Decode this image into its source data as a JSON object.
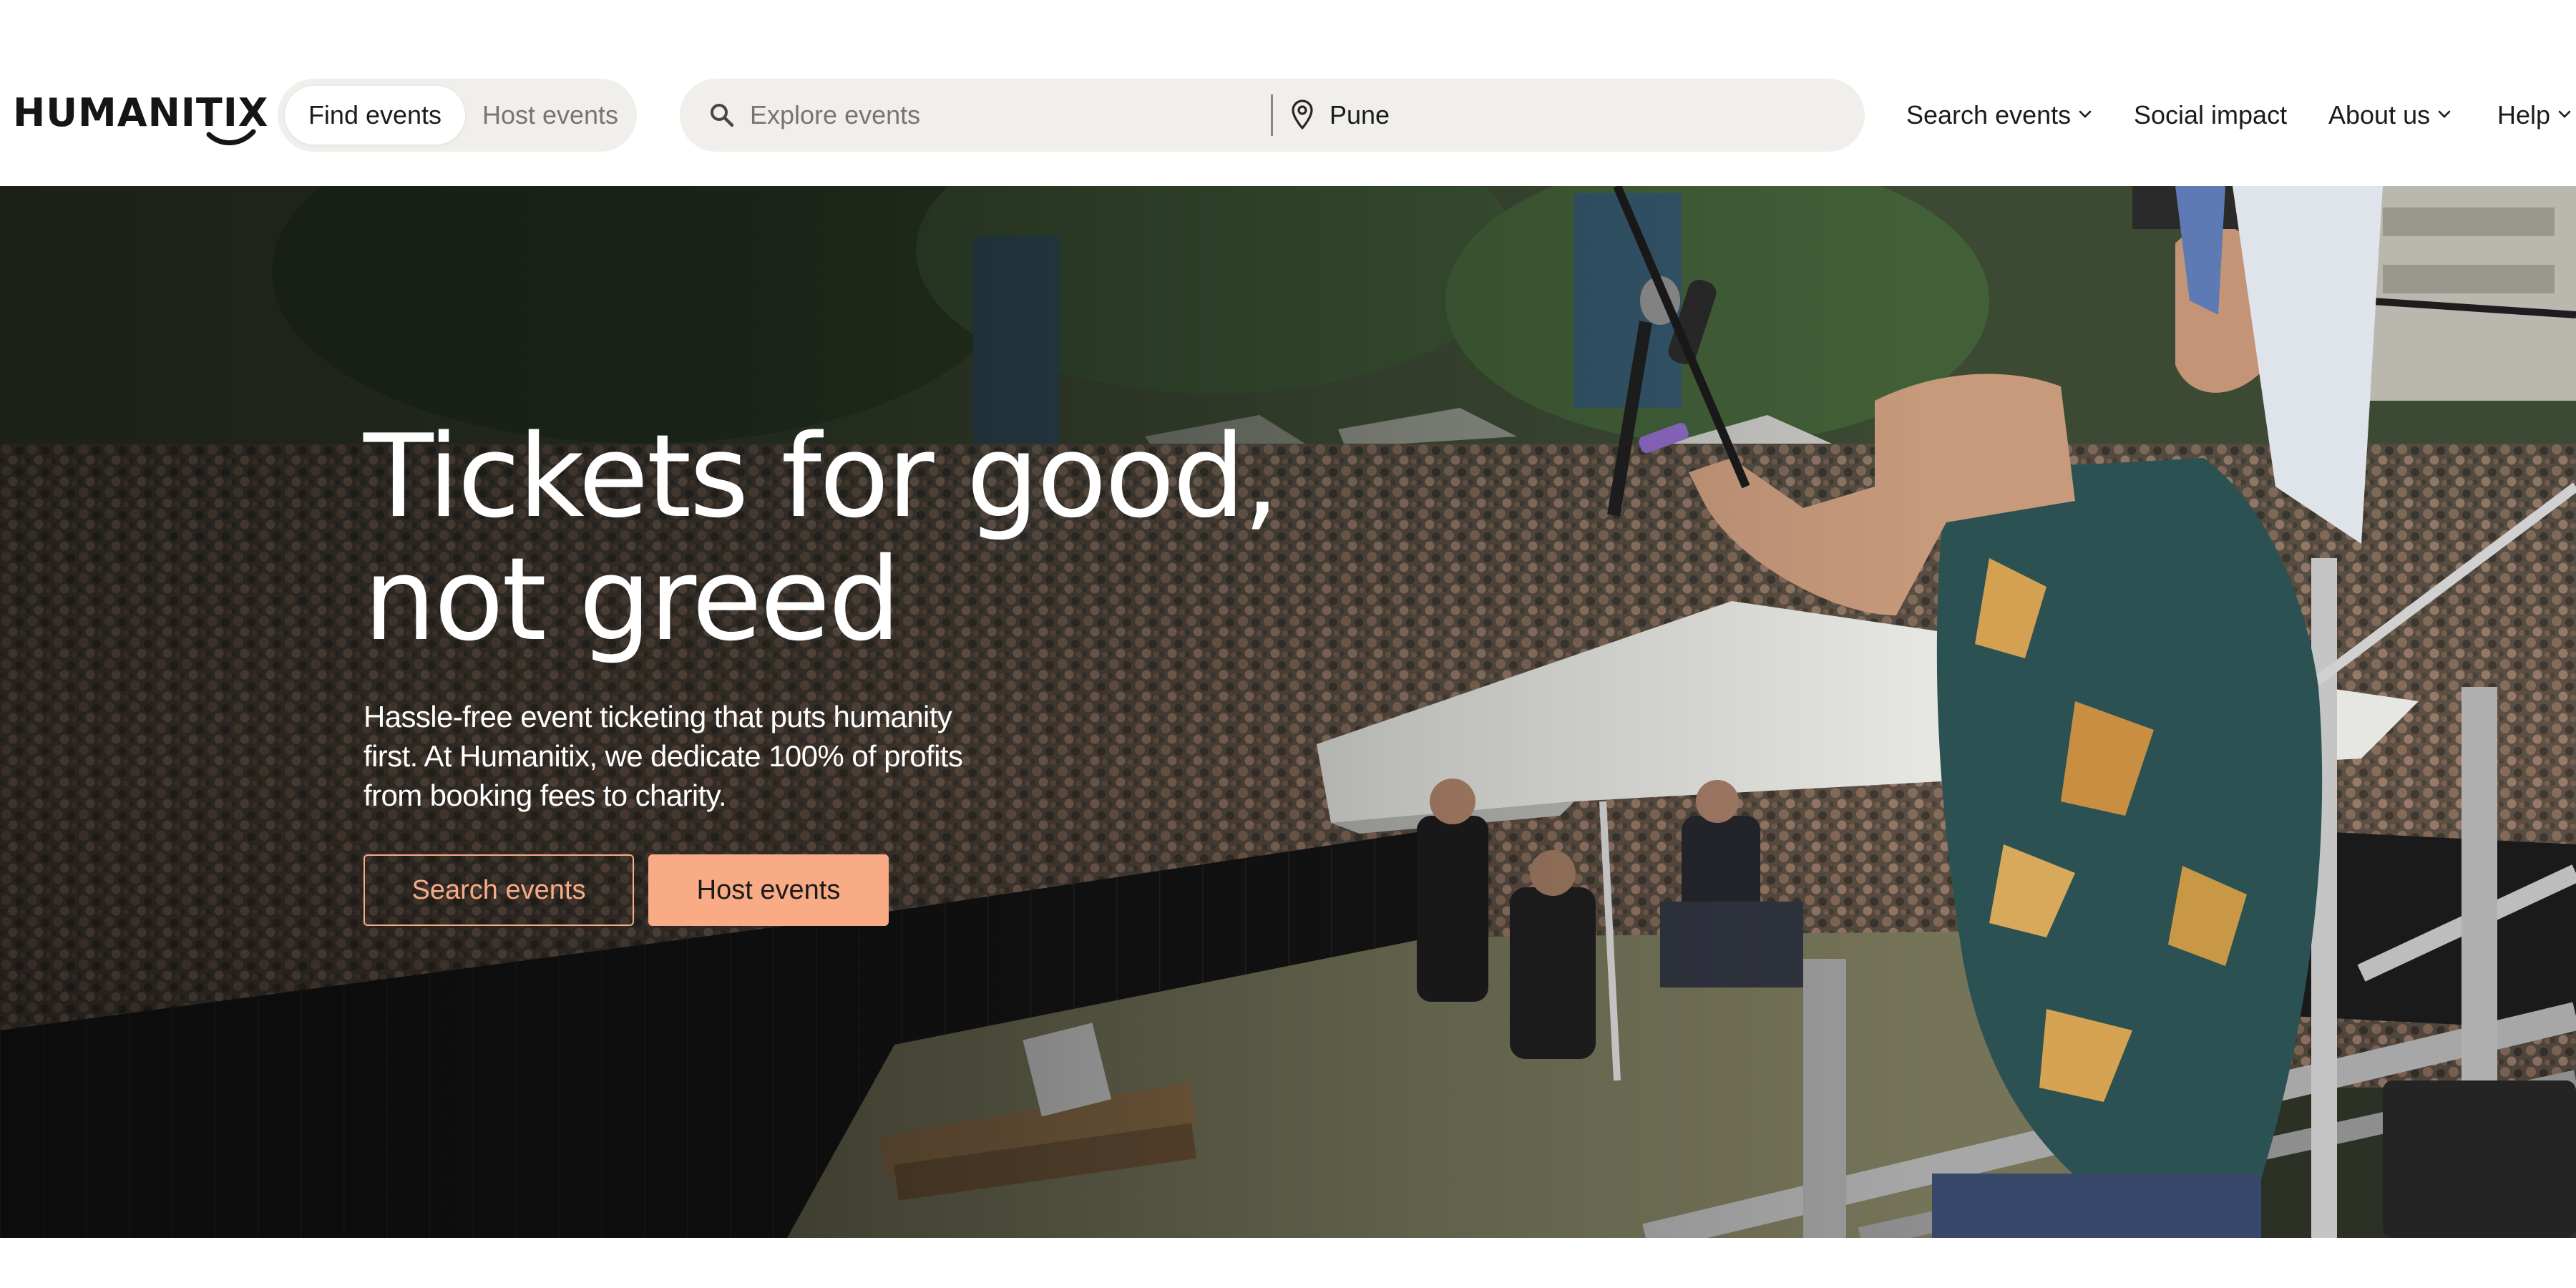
{
  "brand": {
    "name": "HUMANITIX",
    "accent_color": "#f9ab85"
  },
  "header": {
    "mode_toggle": {
      "active_label": "Find events",
      "inactive_label": "Host events"
    },
    "search": {
      "icon": "search-icon",
      "placeholder": "Explore events",
      "value": "",
      "location_icon": "map-pin-icon",
      "location_value": "Pune"
    },
    "nav": [
      {
        "label": "Search events",
        "has_dropdown": true
      },
      {
        "label": "Social impact",
        "has_dropdown": false
      },
      {
        "label": "About us",
        "has_dropdown": true
      },
      {
        "label": "Help",
        "has_dropdown": true
      }
    ]
  },
  "hero": {
    "title_line1": "Tickets for good,",
    "title_line2": "not greed",
    "subtitle_line1": "Hassle-free event ticketing that puts humanity",
    "subtitle_line2": "first. At Humanitix, we dedicate 100% of profits",
    "subtitle_line3": "from booking fees to charity.",
    "primary_button": "Host events",
    "secondary_button": "Search events"
  }
}
